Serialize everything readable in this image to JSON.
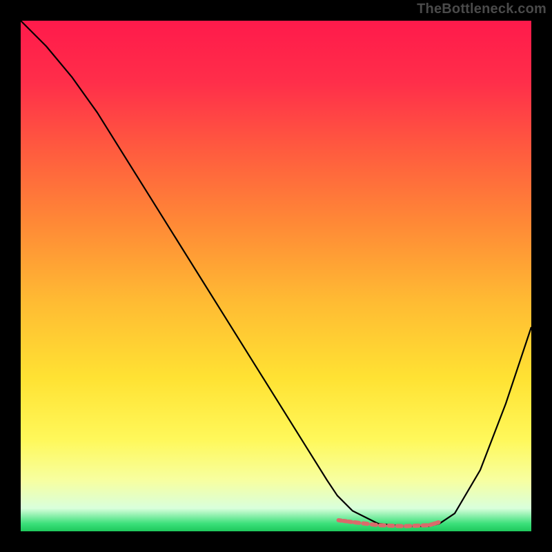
{
  "watermark": "TheBottleneck.com",
  "chart_data": {
    "type": "line",
    "title": "",
    "xlabel": "",
    "ylabel": "",
    "xlim": [
      0,
      100
    ],
    "ylim": [
      0,
      100
    ],
    "grid": false,
    "legend": false,
    "gradient_stops": [
      {
        "offset": 0.0,
        "color": "#ff1a4b"
      },
      {
        "offset": 0.12,
        "color": "#ff2e4a"
      },
      {
        "offset": 0.25,
        "color": "#ff5a3f"
      },
      {
        "offset": 0.4,
        "color": "#ff8a36"
      },
      {
        "offset": 0.55,
        "color": "#ffbb33"
      },
      {
        "offset": 0.7,
        "color": "#ffe233"
      },
      {
        "offset": 0.82,
        "color": "#fff85a"
      },
      {
        "offset": 0.9,
        "color": "#f7ffa0"
      },
      {
        "offset": 0.955,
        "color": "#d9ffdc"
      },
      {
        "offset": 0.985,
        "color": "#3be07a"
      },
      {
        "offset": 1.0,
        "color": "#1ec95c"
      }
    ],
    "series": [
      {
        "name": "bottleneck-curve",
        "stroke": "#000000",
        "x": [
          0,
          5,
          10,
          15,
          20,
          25,
          30,
          35,
          40,
          45,
          50,
          55,
          60,
          62,
          65,
          70,
          75,
          80,
          82,
          85,
          90,
          95,
          100
        ],
        "y": [
          100,
          95,
          89,
          82,
          74,
          66,
          58,
          50,
          42,
          34,
          26,
          18,
          10,
          7,
          4,
          1.5,
          1.0,
          1.0,
          1.5,
          3.5,
          12,
          25,
          40
        ]
      },
      {
        "name": "optimal-band-underline",
        "stroke": "#d96b6b",
        "style": "dashed-dots",
        "x": [
          62,
          65,
          70,
          75,
          80,
          82
        ],
        "y": [
          2.2,
          1.8,
          1.2,
          1.0,
          1.2,
          1.8
        ]
      }
    ]
  }
}
